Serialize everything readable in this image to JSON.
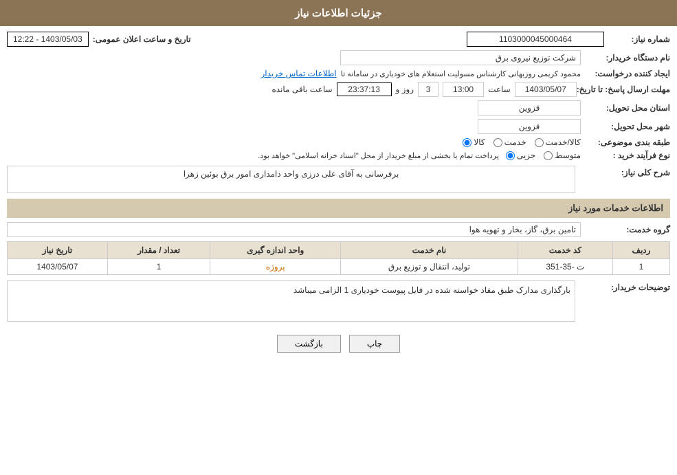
{
  "header": {
    "title": "جزئیات اطلاعات نیاز"
  },
  "need_number": {
    "label": "شماره نیاز:",
    "value": "1103000045000464"
  },
  "announcement_date": {
    "label": "تاریخ و ساعت اعلان عمومی:",
    "value": "1403/05/03 - 12:22"
  },
  "requester_org": {
    "label": "نام دستگاه خریدار:",
    "value": "شرکت توزیع نیروی برق"
  },
  "creator": {
    "label": "ایجاد کننده درخواست:",
    "value": "محمود کریمی روزبهانی کارشناس  مسولیت استعلام های خودیاری در سامانه تا",
    "link_text": "اطلاعات تماس خریدار"
  },
  "deadline": {
    "label": "مهلت ارسال پاسخ: تا تاریخ:",
    "date": "1403/05/07",
    "time_label": "ساعت",
    "time": "13:00",
    "day_label": "روز و",
    "days": "3",
    "remaining_label": "ساعت باقی مانده",
    "remaining": "23:37:13"
  },
  "province": {
    "label": "استان محل تحویل:",
    "value": "قزوین"
  },
  "city": {
    "label": "شهر محل تحویل:",
    "value": "قزوین"
  },
  "category": {
    "label": "طبقه بندی موضوعی:",
    "options": [
      "کالا",
      "خدمت",
      "کالا/خدمت"
    ],
    "selected": "کالا"
  },
  "purchase_type": {
    "label": "نوع فرآیند خرید :",
    "options": [
      "جزیی",
      "متوسط"
    ],
    "notice": "پرداخت تمام یا بخشی از مبلغ خریدار از محل \"اسناد خزانه اسلامی\" خواهد بود."
  },
  "need_description": {
    "section_title": "شرح کلی نیاز:",
    "value": "برفرسانی به آقای علی درزی واحد دامداری امور برق بوئین زهرا"
  },
  "services_section": {
    "title": "اطلاعات خدمات مورد نیاز",
    "service_group_label": "گروه خدمت:",
    "service_group_value": "تامین برق، گاز، بخار و تهویه هوا",
    "table": {
      "columns": [
        "ردیف",
        "کد خدمت",
        "نام خدمت",
        "واحد اندازه گیری",
        "تعداد / مقدار",
        "تاریخ نیاز"
      ],
      "rows": [
        {
          "row": "1",
          "code": "ت -35-351",
          "name": "تولید، انتقال و توزیع برق",
          "unit": "پروژه",
          "count": "1",
          "date": "1403/05/07"
        }
      ]
    }
  },
  "buyer_description": {
    "label": "توضیحات خریدار:",
    "value": "بارگذاری مدارک طبق مفاد خواسته شده در فایل پیوست خودیاری 1 الزامی میباشد"
  },
  "buttons": {
    "print": "چاپ",
    "back": "بازگشت"
  }
}
